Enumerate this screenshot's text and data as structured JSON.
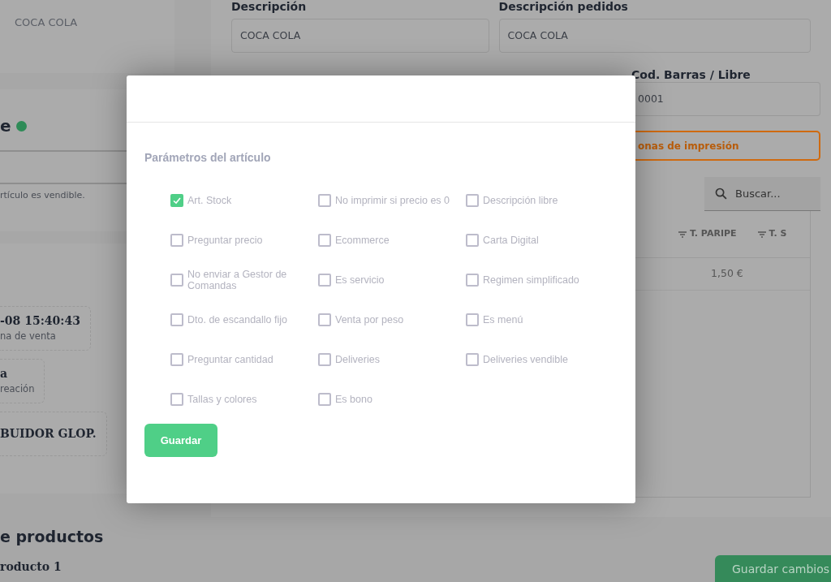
{
  "left_column": {
    "product_name": "COCA COLA",
    "section_title": "e",
    "note": "rtículo es vendible.",
    "info_cards": [
      {
        "value": "-08 15:40:43",
        "label": "na de venta"
      },
      {
        "value": "a",
        "label": "reación"
      },
      {
        "value": "BUIDOR GLOP."
      }
    ],
    "products_heading": "e productos",
    "product_item": "roducto 1"
  },
  "form": {
    "fields": [
      {
        "label": "Descripción",
        "value": "COCA COLA"
      },
      {
        "label": "Descripción pedidos",
        "value": "COCA COLA"
      }
    ],
    "barcode": {
      "label": "Cod. Barras / Libre",
      "value": "0001"
    },
    "print_zones_button": "onas de impresión",
    "search": {
      "placeholder": "Buscar..."
    },
    "table": {
      "columns": [
        "T. PARIPE",
        "T. S"
      ],
      "rows": [
        [
          "1,50 €"
        ]
      ]
    }
  },
  "modal": {
    "section_title": "Parámetros del artículo",
    "options": [
      {
        "label": "Art. Stock",
        "checked": true
      },
      {
        "label": "No imprimir si precio es 0",
        "checked": false
      },
      {
        "label": "Descripción libre",
        "checked": false
      },
      {
        "label": "Preguntar precio",
        "checked": false
      },
      {
        "label": "Ecommerce",
        "checked": false
      },
      {
        "label": "Carta Digital",
        "checked": false
      },
      {
        "label": "No enviar a Gestor de Comandas",
        "checked": false
      },
      {
        "label": "Es servicio",
        "checked": false
      },
      {
        "label": "Regimen simplificado",
        "checked": false
      },
      {
        "label": "Dto. de escandallo fijo",
        "checked": false
      },
      {
        "label": "Venta por peso",
        "checked": false
      },
      {
        "label": "Es menú",
        "checked": false
      },
      {
        "label": "Preguntar cantidad",
        "checked": false
      },
      {
        "label": "Deliveries",
        "checked": false
      },
      {
        "label": "Deliveries vendible",
        "checked": false
      },
      {
        "label": "Tallas y colores",
        "checked": false
      },
      {
        "label": "Es bono",
        "checked": false
      }
    ],
    "save_button": "Guardar"
  },
  "save_changes_button": "Guardar cambios"
}
